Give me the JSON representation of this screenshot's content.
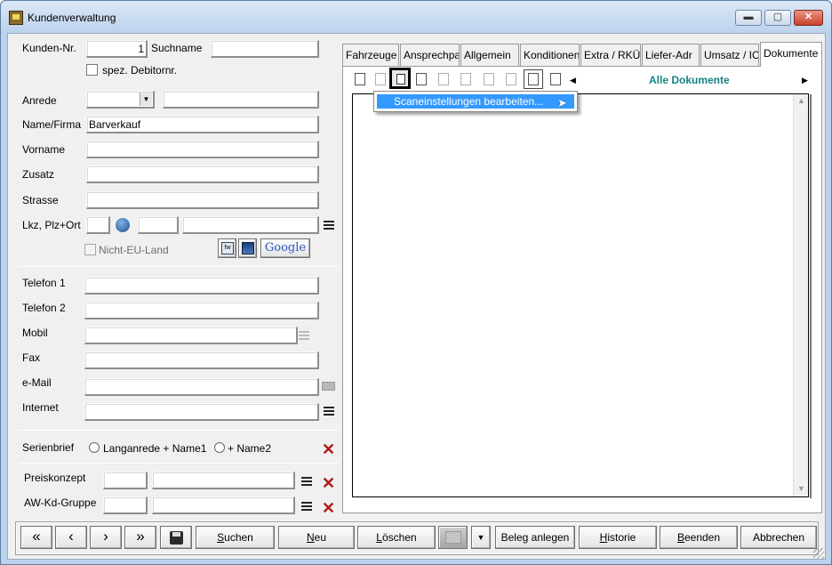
{
  "window": {
    "title": "Kundenverwaltung",
    "minimize_glyph": "▬",
    "maximize_glyph": "▢",
    "close_glyph": "✕"
  },
  "customer": {
    "kunden_nr_label": "Kunden-Nr.",
    "kunden_nr_value": "1",
    "suchname_label": "Suchname",
    "suchname_value": "",
    "spez_debitor_label": "spez. Debitornr.",
    "anrede_label": "Anrede",
    "anrede_value": "",
    "anrede_text_value": "",
    "name_label": "Name/Firma",
    "name_value": "Barverkauf",
    "vorname_label": "Vorname",
    "vorname_value": "",
    "zusatz_label": "Zusatz",
    "zusatz_value": "",
    "strasse_label": "Strasse",
    "strasse_value": "",
    "lkz_label": "Lkz, Plz+Ort",
    "lkz_value": "",
    "plz_value": "",
    "ort_value": "",
    "nicht_eu_label": "Nicht-EU-Land",
    "google_label": "Google"
  },
  "contact": {
    "telefon1_label": "Telefon 1",
    "telefon1_value": "",
    "telefon2_label": "Telefon 2",
    "telefon2_value": "",
    "mobil_label": "Mobil",
    "mobil_value": "",
    "fax_label": "Fax",
    "fax_value": "",
    "email_label": "e-Mail",
    "email_value": "",
    "internet_label": "Internet",
    "internet_value": ""
  },
  "serienbrief": {
    "label": "Serienbrief",
    "option1": "Langanrede + Name1",
    "option2": "+ Name2"
  },
  "pricing": {
    "preiskonzept_label": "Preiskonzept",
    "preiskonzept_code": "",
    "preiskonzept_name": "",
    "awkd_label": "AW-Kd-Gruppe",
    "awkd_code": "",
    "awkd_name": ""
  },
  "tabs": [
    {
      "label": "Fahrzeuge"
    },
    {
      "label": "Ansprechpa"
    },
    {
      "label": "Allgemein"
    },
    {
      "label": "Konditionen"
    },
    {
      "label": "Extra / RKÜ"
    },
    {
      "label": "Liefer-Adr"
    },
    {
      "label": "Umsatz / IC"
    },
    {
      "label": "Dokumente"
    }
  ],
  "documents": {
    "filter_label": "Alle Dokumente",
    "menu_item": "Scaneinstellungen bearbeiten..."
  },
  "buttons": {
    "first": "«",
    "prev": "‹",
    "next": "›",
    "last": "»",
    "save_icon": "floppy-disk-icon",
    "suchen_u": "S",
    "suchen_rest": "uchen",
    "neu_u": "N",
    "neu_rest": "eu",
    "loeschen_u": "L",
    "loeschen_rest": "öschen",
    "beleg": "Beleg anlegen",
    "historie_u": "H",
    "historie_rest": "istorie",
    "beenden_u": "B",
    "beenden_rest": "eenden",
    "abbrechen": "Abbrechen"
  }
}
